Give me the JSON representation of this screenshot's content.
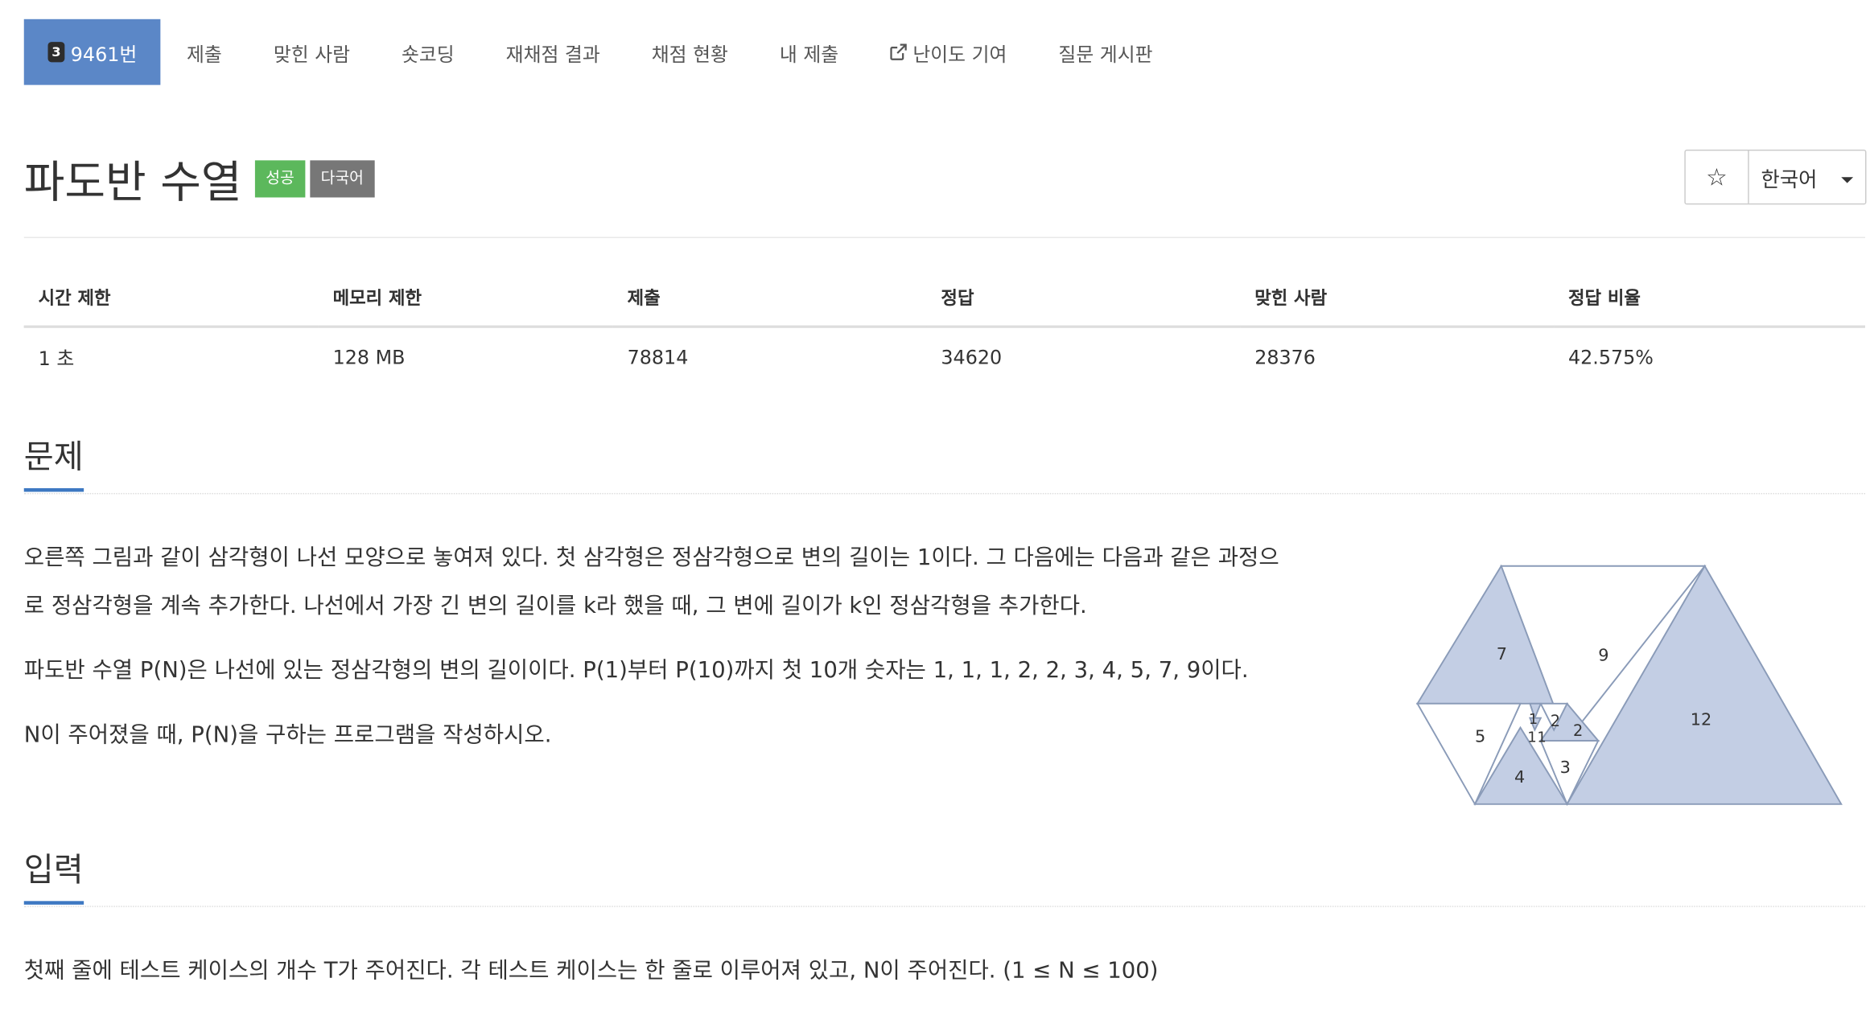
{
  "nav": {
    "tier_number": "3",
    "problem_tab": "9461번",
    "tabs": [
      "제출",
      "맞힌 사람",
      "숏코딩",
      "재채점 결과",
      "채점 현황",
      "내 제출"
    ],
    "contrib_tab": "난이도 기여",
    "board_tab": "질문 게시판"
  },
  "problem": {
    "title": "파도반 수열",
    "badge_success": "성공",
    "badge_multilang": "다국어",
    "star_icon": "☆",
    "language": "한국어"
  },
  "stats": {
    "headers": [
      "시간 제한",
      "메모리 제한",
      "제출",
      "정답",
      "맞힌 사람",
      "정답 비율"
    ],
    "values": [
      "1 초",
      "128 MB",
      "78814",
      "34620",
      "28376",
      "42.575%"
    ]
  },
  "sections": {
    "problem_heading": "문제",
    "problem_line1": "오른쪽 그림과 같이 삼각형이 나선 모양으로 놓여져 있다. 첫 삼각형은 정삼각형으로 변의 길이는 1이다. 그 다음에는 다음과 같은 과정으",
    "problem_line2": "로 정삼각형을 계속 추가한다. 나선에서 가장 긴 변의 길이를 k라 했을 때, 그 변에 길이가 k인 정삼각형을 추가한다.",
    "problem_para2": "파도반 수열 P(N)은 나선에 있는 정삼각형의 변의 길이이다. P(1)부터 P(10)까지 첫 10개 숫자는 1, 1, 1, 2, 2, 3, 4, 5, 7, 9이다.",
    "problem_para3": "N이 주어졌을 때, P(N)을 구하는 프로그램을 작성하시오.",
    "input_heading": "입력",
    "input_para": "첫째 줄에 테스트 케이스의 개수 T가 주어진다. 각 테스트 케이스는 한 줄로 이루어져 있고, N이 주어진다. (1 ≤ N ≤ 100)"
  },
  "figure": {
    "labels": [
      "7",
      "9",
      "1",
      "2",
      "2",
      "1",
      "1",
      "5",
      "12",
      "4",
      "3"
    ],
    "fill_color": "#c3cee4",
    "stroke_color": "#8a9bb8"
  },
  "colors": {
    "accent": "#5b87c7",
    "success": "#5cb85c",
    "multilang": "#777777",
    "heading_underline": "#3d78c2"
  }
}
